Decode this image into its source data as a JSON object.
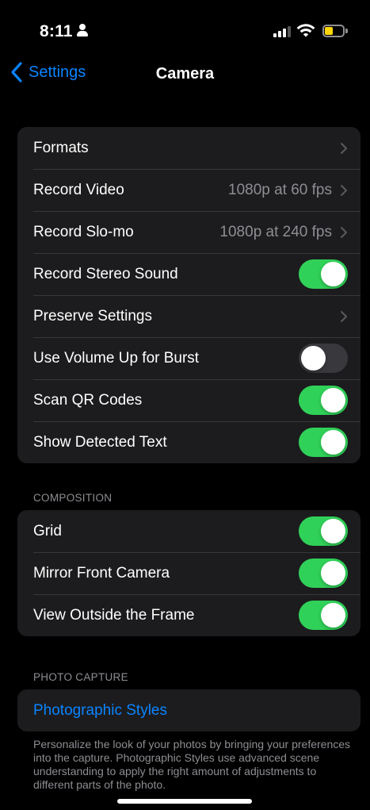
{
  "status_bar": {
    "time": "8:11"
  },
  "nav": {
    "back_label": "Settings",
    "title": "Camera"
  },
  "main_group": [
    {
      "label": "Formats",
      "type": "link"
    },
    {
      "label": "Record Video",
      "detail": "1080p at 60 fps",
      "type": "link"
    },
    {
      "label": "Record Slo-mo",
      "detail": "1080p at 240 fps",
      "type": "link"
    },
    {
      "label": "Record Stereo Sound",
      "type": "toggle",
      "on": true
    },
    {
      "label": "Preserve Settings",
      "type": "link"
    },
    {
      "label": "Use Volume Up for Burst",
      "type": "toggle",
      "on": false
    },
    {
      "label": "Scan QR Codes",
      "type": "toggle",
      "on": true
    },
    {
      "label": "Show Detected Text",
      "type": "toggle",
      "on": true
    }
  ],
  "composition": {
    "header": "COMPOSITION",
    "items": [
      {
        "label": "Grid",
        "type": "toggle",
        "on": true
      },
      {
        "label": "Mirror Front Camera",
        "type": "toggle",
        "on": true
      },
      {
        "label": "View Outside the Frame",
        "type": "toggle",
        "on": true
      }
    ]
  },
  "photo_capture": {
    "header": "PHOTO CAPTURE",
    "link_label": "Photographic Styles",
    "footer": "Personalize the look of your photos by bringing your preferences into the capture. Photographic Styles use advanced scene understanding to apply the right amount of adjustments to different parts of the photo."
  },
  "colors": {
    "accent": "#0a84ff",
    "toggle_on": "#30d158",
    "toggle_off": "#39393d",
    "cell_background": "#1c1c1e",
    "secondary_text": "#8d8d93"
  },
  "icons": [
    "person-icon",
    "signal-icon",
    "wifi-icon",
    "battery-icon",
    "chevron-left-icon",
    "chevron-right-icon"
  ]
}
